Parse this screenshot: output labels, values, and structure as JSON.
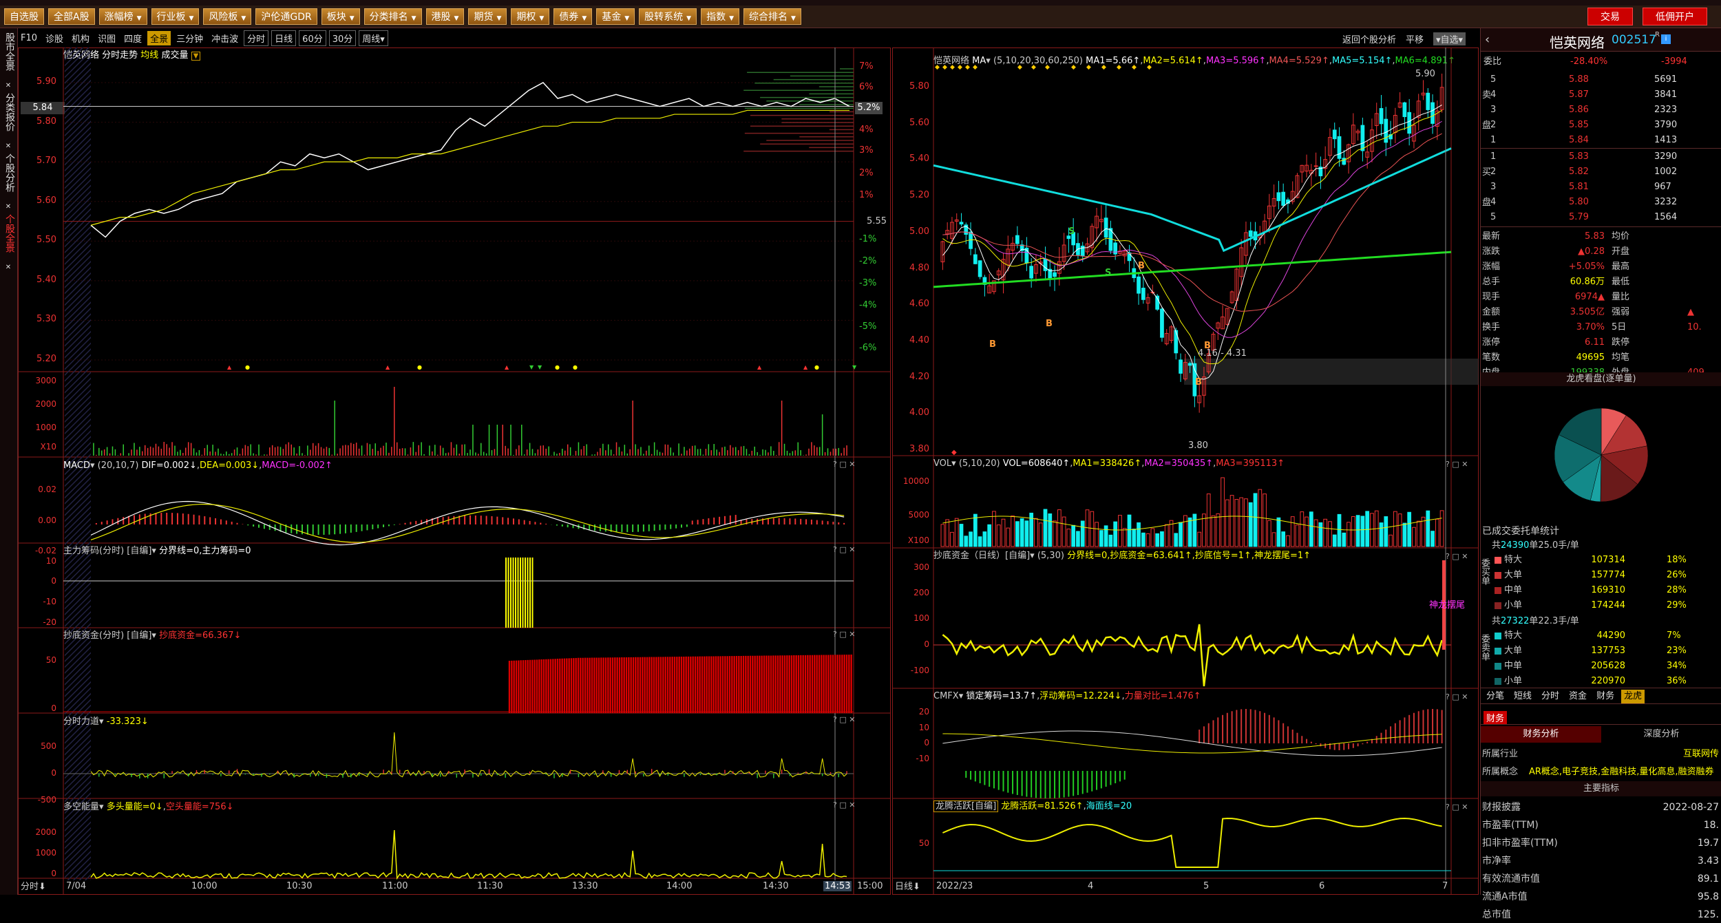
{
  "topbar": {
    "buttons": [
      "自选股",
      "全部A股",
      "涨幅榜",
      "行业板",
      "风险板",
      "沪伦通GDR",
      "板块",
      "分类排名",
      "港股",
      "期货",
      "期权",
      "债券",
      "基金",
      "股转系统",
      "指数",
      "综合排名"
    ],
    "dropdowns": [
      false,
      false,
      true,
      true,
      true,
      false,
      true,
      true,
      true,
      true,
      true,
      true,
      true,
      true,
      true,
      true
    ],
    "trade_label": "交易",
    "open_account_label": "低佣开户"
  },
  "lefttabs": [
    "股市全景",
    "分类报价",
    "个股分析",
    "个股全景"
  ],
  "left_toolbar": {
    "items": [
      "F10",
      "诊股",
      "机构",
      "识图",
      "四度",
      "全景",
      "三分钟",
      "冲击波",
      "分时",
      "日线",
      "60分",
      "30分",
      "周线▾"
    ],
    "active": "全景"
  },
  "right_toolbar": {
    "items": [
      "返回个股分析",
      "平移",
      "▾自选▾"
    ]
  },
  "intraday": {
    "title": "恺英网络 分时走势",
    "legend_avg": "均线",
    "legend_vol": "成交量",
    "price_ticks": [
      "5.90",
      "5.80",
      "5.70",
      "5.60",
      "5.50",
      "5.40",
      "5.30",
      "5.20"
    ],
    "current_price_tag": "5.84",
    "pct_ticks": [
      "7%",
      "6%",
      "5%",
      "4%",
      "3%",
      "2%",
      "1%",
      "-1%",
      "-2%",
      "-3%",
      "-4%",
      "-5%",
      "-6%"
    ],
    "pct_tag": "5.2%",
    "ref_price": "5.55",
    "price_path": [
      5.54,
      5.51,
      5.55,
      5.57,
      5.58,
      5.57,
      5.58,
      5.6,
      5.61,
      5.62,
      5.65,
      5.66,
      5.67,
      5.7,
      5.69,
      5.72,
      5.71,
      5.72,
      5.7,
      5.68,
      5.69,
      5.7,
      5.71,
      5.72,
      5.73,
      5.78,
      5.81,
      5.79,
      5.82,
      5.85,
      5.88,
      5.9,
      5.86,
      5.87,
      5.85,
      5.86,
      5.87,
      5.86,
      5.85,
      5.84,
      5.85,
      5.86,
      5.84,
      5.85,
      5.84,
      5.85,
      5.84,
      5.85,
      5.84,
      5.86,
      5.85,
      5.86,
      5.84
    ],
    "avg_path": [
      5.54,
      5.55,
      5.56,
      5.56,
      5.57,
      5.58,
      5.6,
      5.62,
      5.63,
      5.64,
      5.65,
      5.66,
      5.67,
      5.68,
      5.68,
      5.69,
      5.7,
      5.7,
      5.7,
      5.71,
      5.71,
      5.71,
      5.72,
      5.72,
      5.72,
      5.73,
      5.74,
      5.75,
      5.76,
      5.77,
      5.78,
      5.79,
      5.79,
      5.8,
      5.8,
      5.8,
      5.81,
      5.81,
      5.81,
      5.81,
      5.82,
      5.82,
      5.82,
      5.82,
      5.82,
      5.83,
      5.83,
      5.83,
      5.83,
      5.83,
      5.83,
      5.83,
      5.83
    ]
  },
  "vol_panel": {
    "ticks": [
      "3000",
      "2000",
      "1000",
      "X10"
    ]
  },
  "macd_panel": {
    "title": "MACD",
    "params": "(20,10,7)",
    "dif": "DIF=0.002↓",
    "dea": "DEA=0.003↓",
    "macd": "MACD=-0.002↑",
    "ticks": [
      "0.02",
      "0.00",
      "-0.02"
    ]
  },
  "zlcm_panel": {
    "title": "主力筹码(分时) [自编]",
    "sub": "分界线=0,主力筹码=0",
    "ticks": [
      "10",
      "0",
      "-10",
      "-20"
    ]
  },
  "cdzj_panel": {
    "title": "抄底资金(分时) [自编]",
    "sub": "抄底资金=66.367↓",
    "ticks": [
      "50",
      "0"
    ]
  },
  "fsld_panel": {
    "title": "分时力道",
    "sub": "-33.323↓",
    "ticks": [
      "500",
      "0",
      "-500"
    ]
  },
  "dknl_panel": {
    "title": "多空能量",
    "sub1": "多头量能=0↓",
    "sub2": "空头量能=756↓",
    "ticks": [
      "2000",
      "1000",
      "0"
    ]
  },
  "intraday_xaxis": {
    "label": "分时",
    "ticks": [
      "7/04",
      "10:00",
      "10:30",
      "11:00",
      "11:30",
      "13:30",
      "14:00",
      "14:30",
      "14:53",
      "15:00"
    ]
  },
  "kline": {
    "title": "恺英网络",
    "ma_label": "MA",
    "ma_params": "(5,10,20,30,60,250)",
    "ma1": "MA1=5.66↑",
    "ma2": "MA2=5.614↑",
    "ma3": "MA3=5.596↑",
    "ma4": "MA4=5.529↑",
    "ma5": "MA5=5.154↑",
    "ma6": "MA6=4.891↑",
    "price_ticks": [
      "5.80",
      "5.60",
      "5.40",
      "5.20",
      "5.00",
      "4.80",
      "4.60",
      "4.40",
      "4.20",
      "4.00",
      "3.80"
    ],
    "high_label": "5.90",
    "low_label": "3.80",
    "range_label": "4.16 - 4.31"
  },
  "kvol_panel": {
    "title": "VOL",
    "params": "(5,10,20)",
    "vol": "VOL=608640↑",
    "ma1": "MA1=338426↑",
    "ma2": "MA2=350435↑",
    "ma3": "MA3=395113↑",
    "ticks": [
      "10000",
      "5000",
      "X100"
    ]
  },
  "kcdzj_panel": {
    "title": "抄底资金（日线）[自编]",
    "params": "(5,30)",
    "sub": "分界线=0,抄底资金=63.641↑,抄底信号=1↑,神龙摆尾=1↑",
    "ticks": [
      "300",
      "200",
      "100",
      "0",
      "-100"
    ],
    "tag": "神龙摆尾"
  },
  "cmfx_panel": {
    "title": "CMFX",
    "sub1": "锁定筹码=13.7↑",
    "sub2": "浮动筹码=12.224↓",
    "sub3": "力量对比=1.476↑",
    "ticks": [
      "20",
      "10",
      "0",
      "-10"
    ]
  },
  "lthy_panel": {
    "title": "龙腾活跃[自编]",
    "sub1": "龙腾活跃=81.526↑",
    "sub2": "海面线=20",
    "ticks": [
      "50"
    ]
  },
  "kline_xaxis": {
    "label": "日线",
    "ticks": [
      "2022/2",
      "3",
      "4",
      "5",
      "6",
      "7"
    ]
  },
  "quote": {
    "name": "恺英网络",
    "code": "002517",
    "badge": "R",
    "webi_label": "委比",
    "webi_pct": "-28.40%",
    "webi_diff": "-3994",
    "sells": [
      {
        "lbl": "5",
        "price": "5.88",
        "vol": "5691"
      },
      {
        "lbl": "4",
        "price": "5.87",
        "vol": "3841"
      },
      {
        "lbl": "3",
        "price": "5.86",
        "vol": "2323"
      },
      {
        "lbl": "2",
        "price": "5.85",
        "vol": "3790"
      },
      {
        "lbl": "1",
        "price": "5.84",
        "vol": "1413"
      }
    ],
    "buys": [
      {
        "lbl": "1",
        "price": "5.83",
        "vol": "3290"
      },
      {
        "lbl": "2",
        "price": "5.82",
        "vol": "1002"
      },
      {
        "lbl": "3",
        "price": "5.81",
        "vol": "967"
      },
      {
        "lbl": "4",
        "price": "5.80",
        "vol": "3232"
      },
      {
        "lbl": "5",
        "price": "5.79",
        "vol": "1564"
      }
    ],
    "sell_side": "卖",
    "buy_side": "买",
    "pan": "盘",
    "stats": [
      {
        "k": "最新",
        "v": "5.83",
        "k2": "均价",
        "v2": ""
      },
      {
        "k": "涨跌",
        "v": "▲0.28",
        "k2": "开盘",
        "v2": ""
      },
      {
        "k": "涨幅",
        "v": "+5.05%",
        "k2": "最高",
        "v2": ""
      },
      {
        "k": "总手",
        "v": "60.86万",
        "k2": "最低",
        "v2": ""
      },
      {
        "k": "现手",
        "v": "6974▲",
        "k2": "量比",
        "v2": ""
      },
      {
        "k": "金额",
        "v": "3.505亿",
        "k2": "强弱",
        "v2": "▲"
      },
      {
        "k": "换手",
        "v": "3.70%",
        "k2": "5日",
        "v2": "10."
      },
      {
        "k": "涨停",
        "v": "6.11",
        "k2": "跌停",
        "v2": ""
      },
      {
        "k": "笔数",
        "v": "49695",
        "k2": "均笔",
        "v2": ""
      },
      {
        "k": "内盘",
        "v": "199338",
        "k2": "外盘",
        "v2": "409"
      }
    ],
    "pie_title": "龙虎看盘(逐单量)",
    "orders_title": "已成交委托单统计",
    "buy_total_pre": "共",
    "buy_total": "24390",
    "buy_unit": "单25.0手/单",
    "buy_side_label": "委买单",
    "buy_rows": [
      {
        "k": "特大",
        "v": "107314",
        "p": "18%"
      },
      {
        "k": "大单",
        "v": "157774",
        "p": "26%"
      },
      {
        "k": "中单",
        "v": "169310",
        "p": "28%"
      },
      {
        "k": "小单",
        "v": "174244",
        "p": "29%"
      }
    ],
    "sell_total_pre": "共",
    "sell_total": "27322",
    "sell_unit": "单22.3手/单",
    "sell_side_label": "委卖单",
    "sell_rows": [
      {
        "k": "特大",
        "v": "44290",
        "p": "7%"
      },
      {
        "k": "大单",
        "v": "137753",
        "p": "23%"
      },
      {
        "k": "中单",
        "v": "205628",
        "p": "34%"
      },
      {
        "k": "小单",
        "v": "220970",
        "p": "36%"
      }
    ],
    "tabs": [
      "分笔",
      "短线",
      "分时",
      "资金",
      "财务",
      "龙虎"
    ],
    "active_tab": "龙虎",
    "fin_tab": "财务",
    "fin_sub_tabs": [
      "财务分析",
      "深度分析"
    ],
    "industry_label": "所属行业",
    "industry": "互联网传",
    "concept_label": "所属概念",
    "concept": "AR概念,电子竞技,金融科技,量化高息,融资融券",
    "main_idx": "主要指标",
    "fin_rows": [
      {
        "k": "财报披露",
        "v": "2022-08-27"
      },
      {
        "k": "市盈率(TTM)",
        "v": "18."
      },
      {
        "k": "扣非市盈率(TTM)",
        "v": "19.7"
      },
      {
        "k": "市净率",
        "v": "3.43"
      },
      {
        "k": "有效流通市值",
        "v": "89.1"
      },
      {
        "k": "流通A市值",
        "v": "95.8"
      },
      {
        "k": "总市值",
        "v": "125."
      }
    ]
  },
  "pie": [
    {
      "color": "#e85a5a",
      "value": 18
    },
    {
      "color": "#b33333",
      "value": 26
    },
    {
      "color": "#8a2020",
      "value": 28
    },
    {
      "color": "#6a1a1a",
      "value": 29
    },
    {
      "color": "#1aa3a3",
      "value": 7
    },
    {
      "color": "#138a8a",
      "value": 23
    },
    {
      "color": "#0e6d6d",
      "value": 34
    },
    {
      "color": "#0a5050",
      "value": 36
    }
  ]
}
